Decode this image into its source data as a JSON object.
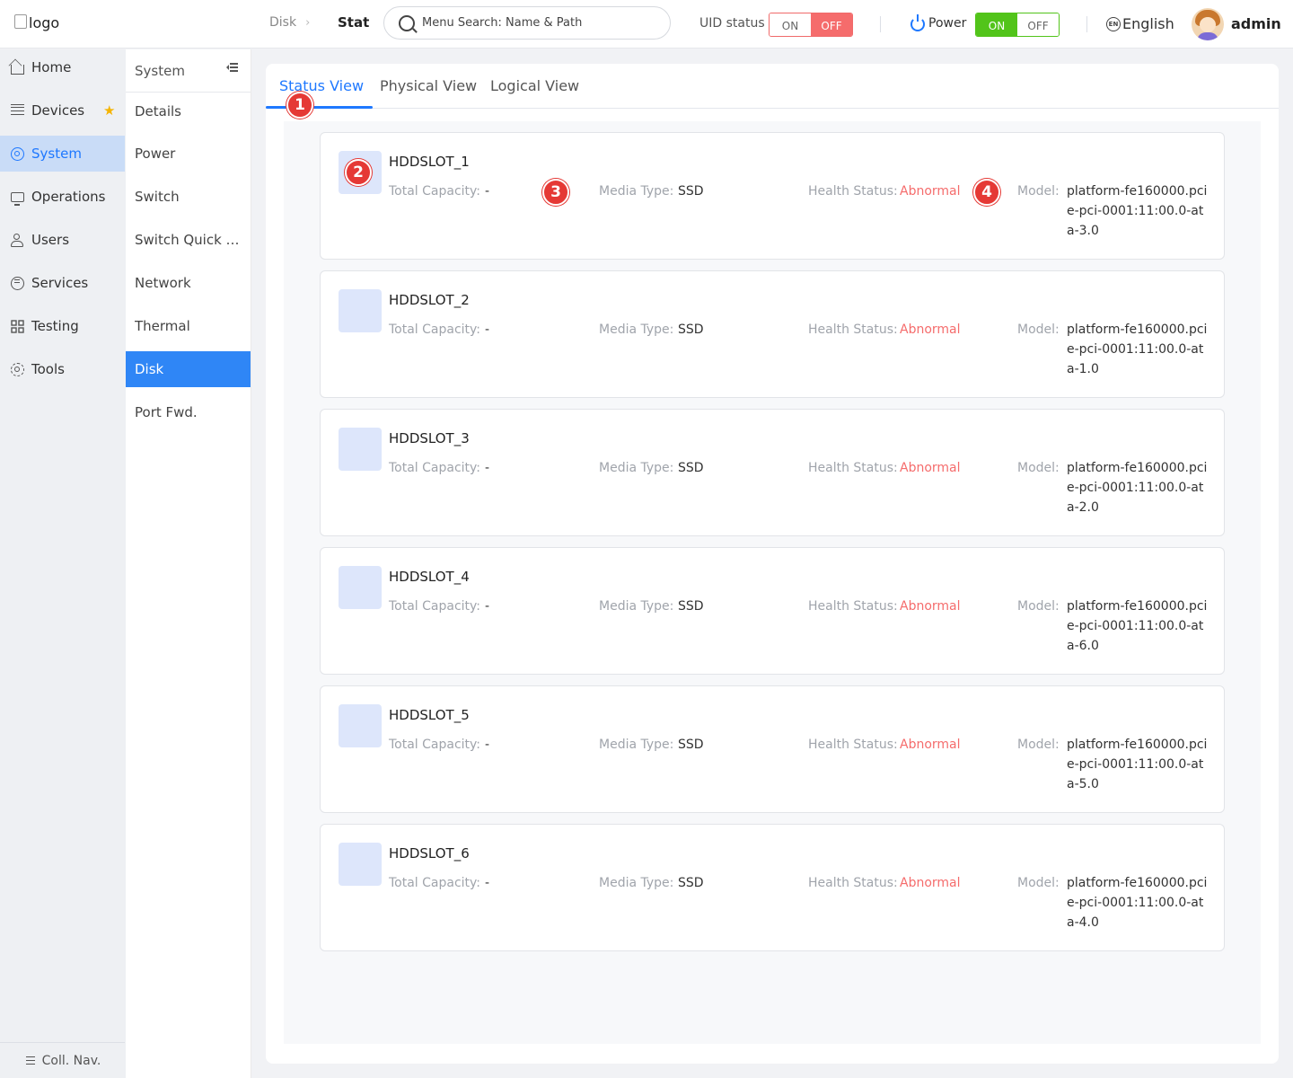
{
  "header": {
    "logo_alt": "logo",
    "breadcrumb_parent": "Disk",
    "breadcrumb_current": "Stat",
    "search_placeholder": "Menu Search: Name & Path",
    "uid_label": "UID status",
    "uid_on": "ON",
    "uid_off": "OFF",
    "power_label": "Power",
    "power_on": "ON",
    "power_off": "OFF",
    "language": "English",
    "lang_badge": "EN",
    "user": "admin"
  },
  "leftnav": {
    "items": [
      {
        "label": "Home",
        "icon": "home-icon"
      },
      {
        "label": "Devices",
        "icon": "devices-icon"
      },
      {
        "label": "System",
        "icon": "system-icon"
      },
      {
        "label": "Operations",
        "icon": "operations-icon"
      },
      {
        "label": "Users",
        "icon": "users-icon"
      },
      {
        "label": "Services",
        "icon": "services-icon"
      },
      {
        "label": "Testing",
        "icon": "testing-icon"
      },
      {
        "label": "Tools",
        "icon": "tools-icon"
      }
    ],
    "favorite_glyph": "★",
    "active": "System",
    "footer": "Coll. Nav."
  },
  "subnav": {
    "title": "System",
    "items": [
      "Details",
      "Power",
      "Switch",
      "Switch Quick Setup",
      "Network",
      "Thermal",
      "Disk",
      "Port Fwd."
    ],
    "active": "Disk"
  },
  "tabs": [
    "Status View",
    "Physical View",
    "Logical View"
  ],
  "labels": {
    "total_capacity": "Total Capacity:",
    "media_type": "Media Type:",
    "health_status": "Health Status:",
    "model": "Model:"
  },
  "disks": [
    {
      "name": "HDDSLOT_1",
      "capacity": "-",
      "media": "SSD",
      "health": "Abnormal",
      "model": "platform-fe160000.pcie-pci-0001:11:00.0-ata-3.0"
    },
    {
      "name": "HDDSLOT_2",
      "capacity": "-",
      "media": "SSD",
      "health": "Abnormal",
      "model": "platform-fe160000.pcie-pci-0001:11:00.0-ata-1.0"
    },
    {
      "name": "HDDSLOT_3",
      "capacity": "-",
      "media": "SSD",
      "health": "Abnormal",
      "model": "platform-fe160000.pcie-pci-0001:11:00.0-ata-2.0"
    },
    {
      "name": "HDDSLOT_4",
      "capacity": "-",
      "media": "SSD",
      "health": "Abnormal",
      "model": "platform-fe160000.pcie-pci-0001:11:00.0-ata-6.0"
    },
    {
      "name": "HDDSLOT_5",
      "capacity": "-",
      "media": "SSD",
      "health": "Abnormal",
      "model": "platform-fe160000.pcie-pci-0001:11:00.0-ata-5.0"
    },
    {
      "name": "HDDSLOT_6",
      "capacity": "-",
      "media": "SSD",
      "health": "Abnormal",
      "model": "platform-fe160000.pcie-pci-0001:11:00.0-ata-4.0"
    }
  ],
  "markers": [
    "1",
    "2",
    "3",
    "4"
  ],
  "colors": {
    "accent": "#1e78ff",
    "abnormal": "#f56c6c",
    "power_on": "#52c41a",
    "uid_off": "#f56c6c",
    "marker": "#e53935"
  }
}
